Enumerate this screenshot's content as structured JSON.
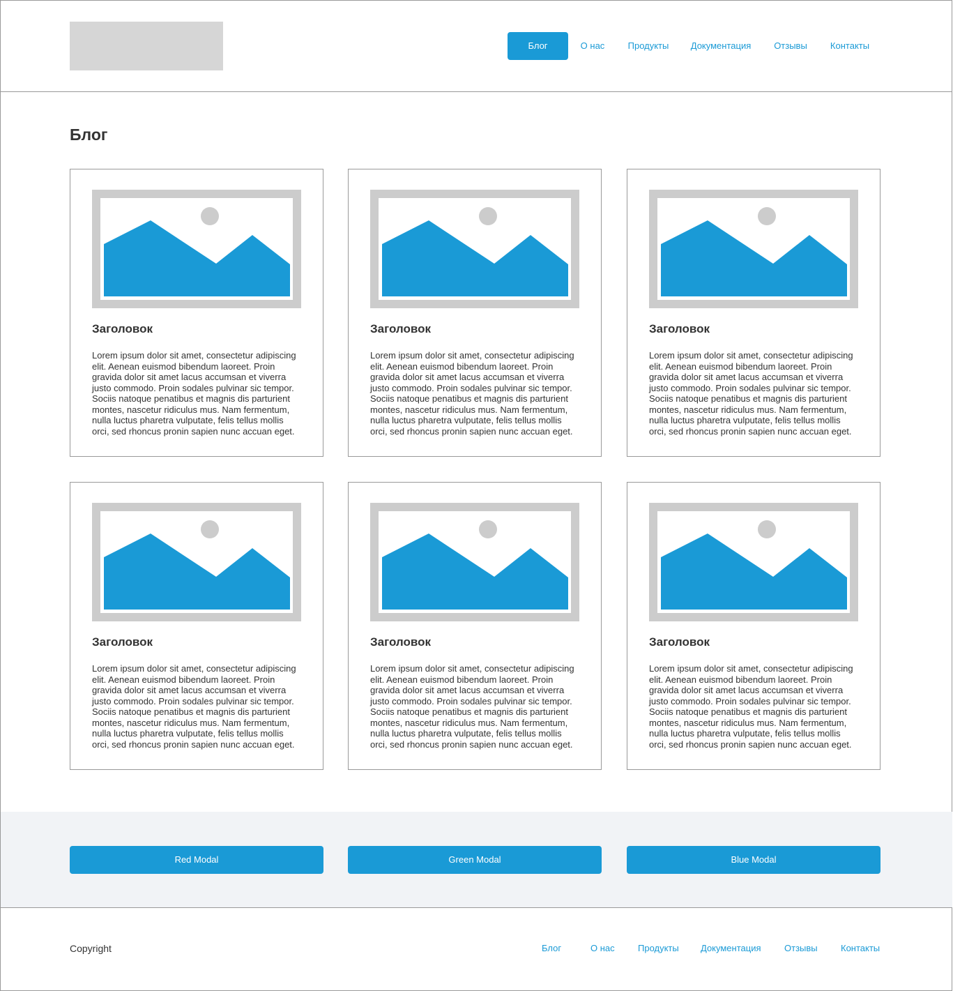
{
  "header": {
    "nav": [
      {
        "label": "Блог",
        "active": true
      },
      {
        "label": "О нас",
        "active": false
      },
      {
        "label": "Продукты",
        "active": false
      },
      {
        "label": "Документация",
        "active": false
      },
      {
        "label": "Отзывы",
        "active": false
      },
      {
        "label": "Контакты",
        "active": false
      }
    ]
  },
  "main": {
    "title": "Блог",
    "cards": [
      {
        "title": "Заголовок",
        "text": "Lorem ipsum dolor sit amet, consectetur adipiscing elit. Aenean euismod bibendum laoreet. Proin gravida dolor sit amet lacus accumsan et viverra justo commodo. Proin sodales pulvinar sic tempor. Sociis natoque penatibus et magnis dis parturient montes, nascetur ridiculus mus. Nam fermentum, nulla luctus pharetra vulputate, felis tellus mollis orci, sed rhoncus pronin sapien nunc accuan eget."
      },
      {
        "title": "Заголовок",
        "text": "Lorem ipsum dolor sit amet, consectetur adipiscing elit. Aenean euismod bibendum laoreet. Proin gravida dolor sit amet lacus accumsan et viverra justo commodo. Proin sodales pulvinar sic tempor. Sociis natoque penatibus et magnis dis parturient montes, nascetur ridiculus mus. Nam fermentum, nulla luctus pharetra vulputate, felis tellus mollis orci, sed rhoncus pronin sapien nunc accuan eget."
      },
      {
        "title": "Заголовок",
        "text": "Lorem ipsum dolor sit amet, consectetur adipiscing elit. Aenean euismod bibendum laoreet. Proin gravida dolor sit amet lacus accumsan et viverra justo commodo. Proin sodales pulvinar sic tempor. Sociis natoque penatibus et magnis dis parturient montes, nascetur ridiculus mus. Nam fermentum, nulla luctus pharetra vulputate, felis tellus mollis orci, sed rhoncus pronin sapien nunc accuan eget."
      },
      {
        "title": "Заголовок",
        "text": "Lorem ipsum dolor sit amet, consectetur adipiscing elit. Aenean euismod bibendum laoreet. Proin gravida dolor sit amet lacus accumsan et viverra justo commodo. Proin sodales pulvinar sic tempor. Sociis natoque penatibus et magnis dis parturient montes, nascetur ridiculus mus. Nam fermentum, nulla luctus pharetra vulputate, felis tellus mollis orci, sed rhoncus pronin sapien nunc accuan eget."
      },
      {
        "title": "Заголовок",
        "text": "Lorem ipsum dolor sit amet, consectetur adipiscing elit. Aenean euismod bibendum laoreet. Proin gravida dolor sit amet lacus accumsan et viverra justo commodo. Proin sodales pulvinar sic tempor. Sociis natoque penatibus et magnis dis parturient montes, nascetur ridiculus mus. Nam fermentum, nulla luctus pharetra vulputate, felis tellus mollis orci, sed rhoncus pronin sapien nunc accuan eget."
      },
      {
        "title": "Заголовок",
        "text": "Lorem ipsum dolor sit amet, consectetur adipiscing elit. Aenean euismod bibendum laoreet. Proin gravida dolor sit amet lacus accumsan et viverra justo commodo. Proin sodales pulvinar sic tempor. Sociis natoque penatibus et magnis dis parturient montes, nascetur ridiculus mus. Nam fermentum, nulla luctus pharetra vulputate, felis tellus mollis orci, sed rhoncus pronin sapien nunc accuan eget."
      }
    ]
  },
  "modals": {
    "buttons": [
      {
        "label": "Red Modal"
      },
      {
        "label": "Green Modal"
      },
      {
        "label": "Blue Modal"
      }
    ]
  },
  "footer": {
    "copyright": "Copyright",
    "nav": [
      {
        "label": "Блог"
      },
      {
        "label": "О нас"
      },
      {
        "label": "Продукты"
      },
      {
        "label": "Документация"
      },
      {
        "label": "Отзывы"
      },
      {
        "label": "Контакты"
      }
    ]
  },
  "colors": {
    "accent": "#1a9ad6",
    "placeholder": "#cccccc",
    "strip_bg": "#f1f3f6"
  }
}
